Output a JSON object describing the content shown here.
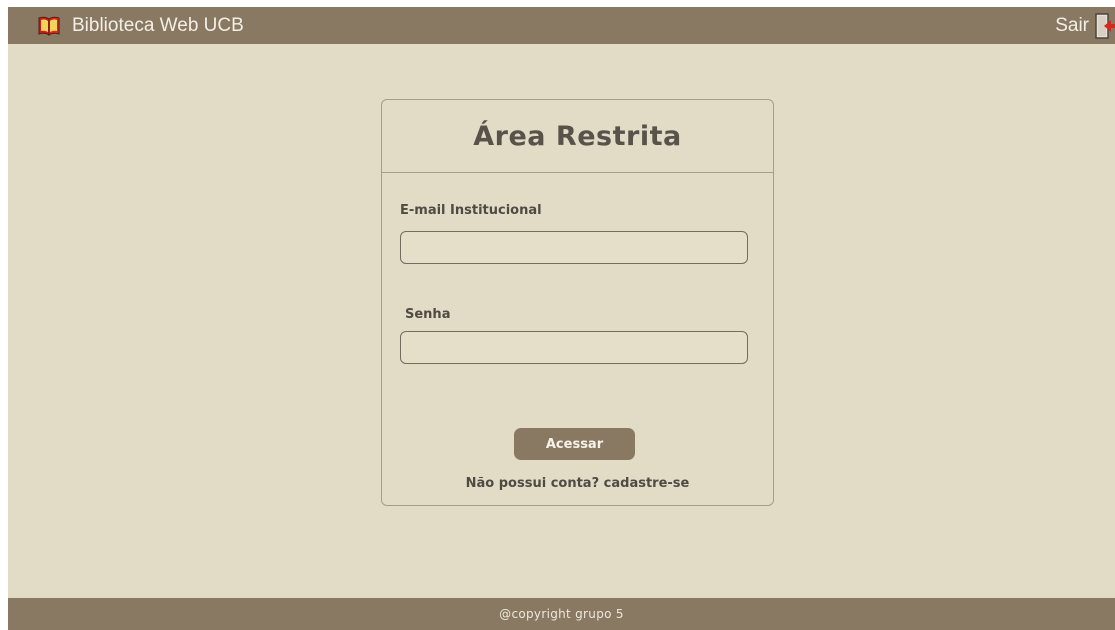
{
  "header": {
    "brand_title": "Biblioteca Web UCB",
    "brand_icon": "open-book-icon",
    "logout_label": "Sair",
    "logout_icon": "exit-door-icon"
  },
  "login": {
    "title": "Área Restrita",
    "email_label": "E-mail Institucional",
    "email_value": "",
    "password_label": "Senha",
    "password_value": "",
    "submit_label": "Acessar",
    "no_account_text": "Não possui conta?",
    "signup_link": "cadastre-se"
  },
  "footer": {
    "text": "@copyright grupo 5"
  },
  "colors": {
    "bar": "#8a7962",
    "background": "#e2dcc6",
    "text": "#4f4a43"
  }
}
